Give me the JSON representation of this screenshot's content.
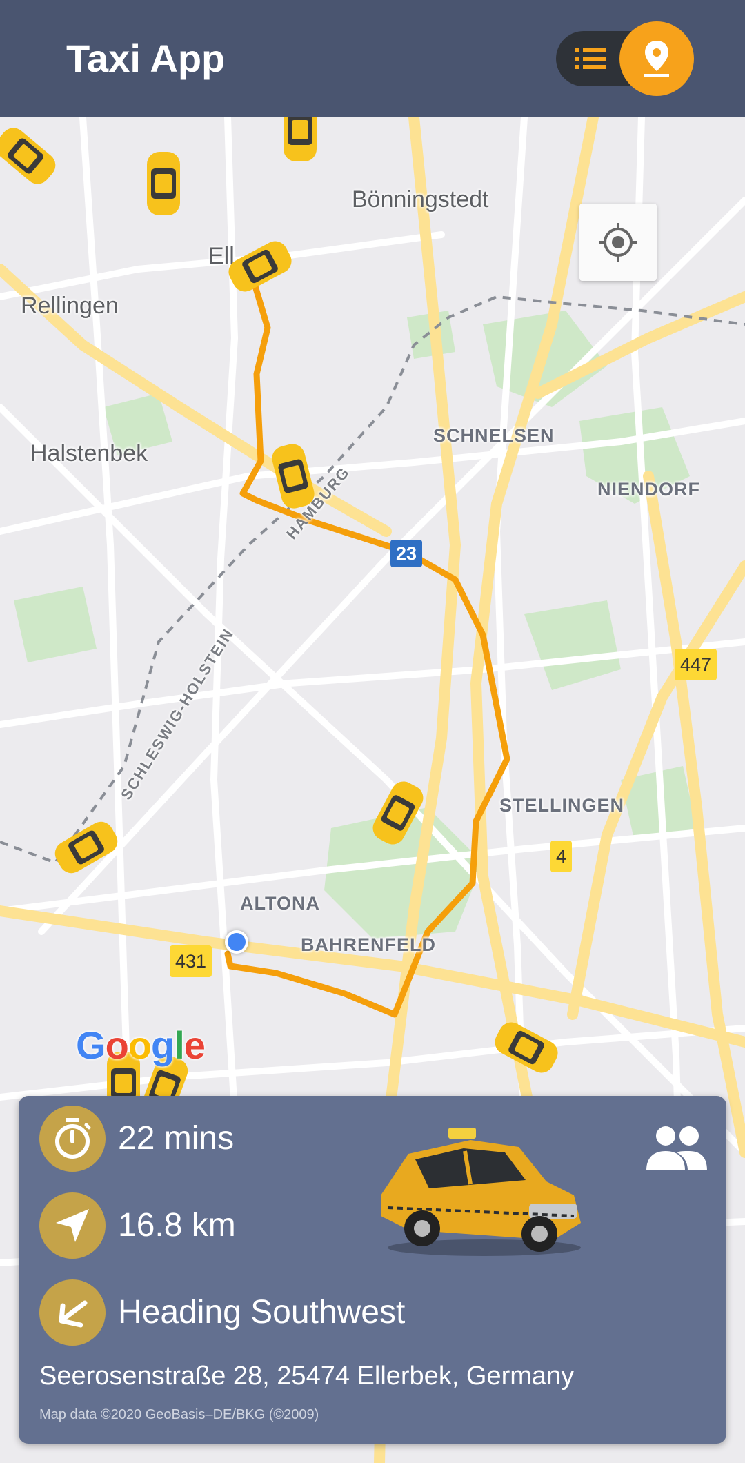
{
  "app": {
    "title": "Taxi App"
  },
  "view_toggle": {
    "list_icon": "list-icon",
    "map_icon": "location-pin-icon",
    "active": "map"
  },
  "map": {
    "place_labels": [
      "Bönningstedt",
      "Rellingen",
      "Halstenbek",
      "Ell"
    ],
    "district_labels": [
      "SCHNELSEN",
      "NIENDORF",
      "STELLINGEN",
      "ALTONA",
      "BAHRENFELD"
    ],
    "state_labels": [
      "HAMBURG",
      "SCHLESWIG-HOLSTEIN"
    ],
    "road_shields": [
      "23",
      "447",
      "4",
      "431"
    ],
    "google_logo": "Google",
    "locate_icon": "crosshair-icon",
    "colors": {
      "route": "#f59f0b",
      "major_road": "#fde293",
      "park": "#cfe8c8",
      "user_location": "#4285f4"
    }
  },
  "trip": {
    "duration": "22 mins",
    "distance": "16.8 km",
    "heading": "Heading Southwest",
    "address": "Seerosenstraße 28, 25474 Ellerbek, Germany",
    "attribution": "Map data ©2020 GeoBasis–DE/BKG (©2009)",
    "icons": {
      "duration": "timer-icon",
      "distance": "navigation-arrow-icon",
      "heading": "arrow-southwest-icon",
      "passengers": "people-icon",
      "vehicle": "yellow-taxi-image"
    },
    "accent_color": "#c5a349"
  }
}
